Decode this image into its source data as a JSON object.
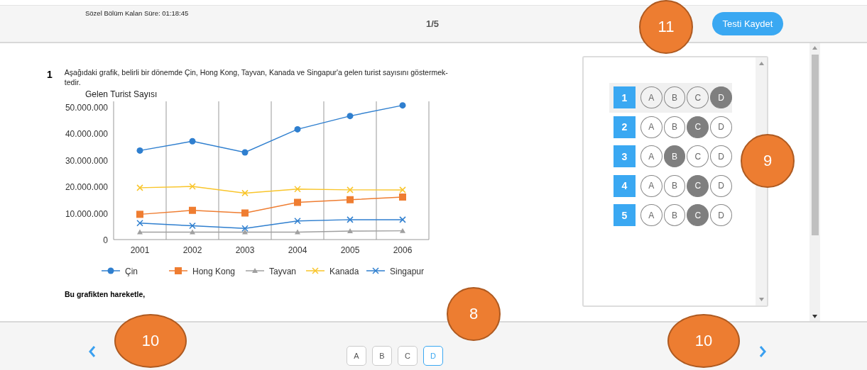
{
  "header": {
    "timer": "Sözel Bölüm Kalan Süre: 01:18:45",
    "question_counter": "1/5",
    "save_button": "Testi Kaydet"
  },
  "question": {
    "number": "1",
    "text": "Aşağıdaki grafik, belirli bir dönemde Çin, Hong Kong, Tayvan, Kanada ve Singapur'a gelen turist sayısını göstermek-\ntedir.",
    "lead": "Bu grafikten hareketle,",
    "chart_data": {
      "type": "line",
      "title": "Gelen Turist Sayısı",
      "categories": [
        "2001",
        "2002",
        "2003",
        "2004",
        "2005",
        "2006"
      ],
      "ylim": [
        0,
        52000000
      ],
      "legend": true,
      "yticks": [
        {
          "value": 0,
          "label": "0"
        },
        {
          "value": 10000000,
          "label": "10.000.000"
        },
        {
          "value": 20000000,
          "label": "20.000.000"
        },
        {
          "value": 30000000,
          "label": "30.000.000"
        },
        {
          "value": 40000000,
          "label": "40.000.000"
        },
        {
          "value": 50000000,
          "label": "50.000.000"
        }
      ],
      "series": [
        {
          "name": "Çin",
          "color": "#2f7fcf",
          "marker": "circle",
          "values": [
            33500000,
            37000000,
            32800000,
            41500000,
            46500000,
            50500000
          ]
        },
        {
          "name": "Hong Kong",
          "color": "#ef7d31",
          "marker": "square",
          "values": [
            9500000,
            11000000,
            10000000,
            14000000,
            15000000,
            16000000
          ]
        },
        {
          "name": "Tayvan",
          "color": "#a0a0a0",
          "marker": "triangle",
          "values": [
            2800000,
            2800000,
            2800000,
            2800000,
            3200000,
            3300000
          ]
        },
        {
          "name": "Kanada",
          "color": "#f9c52a",
          "marker": "cross",
          "values": [
            19500000,
            20000000,
            17500000,
            19000000,
            18700000,
            18700000
          ]
        },
        {
          "name": "Singapur",
          "color": "#2f7fcf",
          "marker": "cross",
          "values": [
            6200000,
            5200000,
            4200000,
            7000000,
            7500000,
            7500000
          ]
        }
      ]
    }
  },
  "answer_sheet": {
    "rows": [
      {
        "number": "1",
        "current": true,
        "options": [
          {
            "label": "A",
            "selected": false
          },
          {
            "label": "B",
            "selected": false
          },
          {
            "label": "C",
            "selected": false
          },
          {
            "label": "D",
            "selected": true
          }
        ]
      },
      {
        "number": "2",
        "current": false,
        "options": [
          {
            "label": "A",
            "selected": false
          },
          {
            "label": "B",
            "selected": false
          },
          {
            "label": "C",
            "selected": true
          },
          {
            "label": "D",
            "selected": false
          }
        ]
      },
      {
        "number": "3",
        "current": false,
        "options": [
          {
            "label": "A",
            "selected": false
          },
          {
            "label": "B",
            "selected": true
          },
          {
            "label": "C",
            "selected": false
          },
          {
            "label": "D",
            "selected": false
          }
        ]
      },
      {
        "number": "4",
        "current": false,
        "options": [
          {
            "label": "A",
            "selected": false
          },
          {
            "label": "B",
            "selected": false
          },
          {
            "label": "C",
            "selected": true
          },
          {
            "label": "D",
            "selected": false
          }
        ]
      },
      {
        "number": "5",
        "current": false,
        "options": [
          {
            "label": "A",
            "selected": false
          },
          {
            "label": "B",
            "selected": false
          },
          {
            "label": "C",
            "selected": true
          },
          {
            "label": "D",
            "selected": false
          }
        ]
      }
    ]
  },
  "footer": {
    "options": [
      {
        "label": "A",
        "selected": false
      },
      {
        "label": "B",
        "selected": false
      },
      {
        "label": "C",
        "selected": false
      },
      {
        "label": "D",
        "selected": true
      }
    ]
  },
  "callouts": [
    {
      "label": "11",
      "kind": "round"
    },
    {
      "label": "9",
      "kind": "round"
    },
    {
      "label": "8",
      "kind": "round"
    },
    {
      "label": "10",
      "kind": "wide"
    },
    {
      "label": "10",
      "kind": "wide"
    }
  ]
}
